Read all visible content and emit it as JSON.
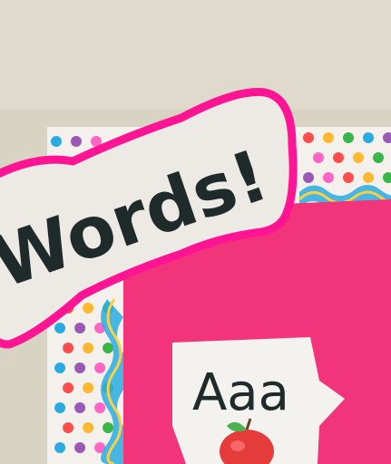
{
  "banner": {
    "text": "Words!"
  },
  "card": {
    "letters": "Aaa"
  },
  "colors": {
    "wall": "#d9d3c3",
    "board": "#f2357a",
    "banner_border": "#ff1493",
    "banner_fill": "#ede9e4",
    "text": "#1f2a2a",
    "apple": "#e63b3b",
    "leaf": "#4caf50"
  },
  "decor": {
    "polka_dot_colors": [
      "#ff4d4d",
      "#ffb830",
      "#39b54a",
      "#29abe2",
      "#9b59b6",
      "#ff66c4"
    ],
    "wave_colors": [
      "#29abe2",
      "#f7d046",
      "#f7f7f7"
    ]
  },
  "icons": [
    "apple-icon"
  ]
}
